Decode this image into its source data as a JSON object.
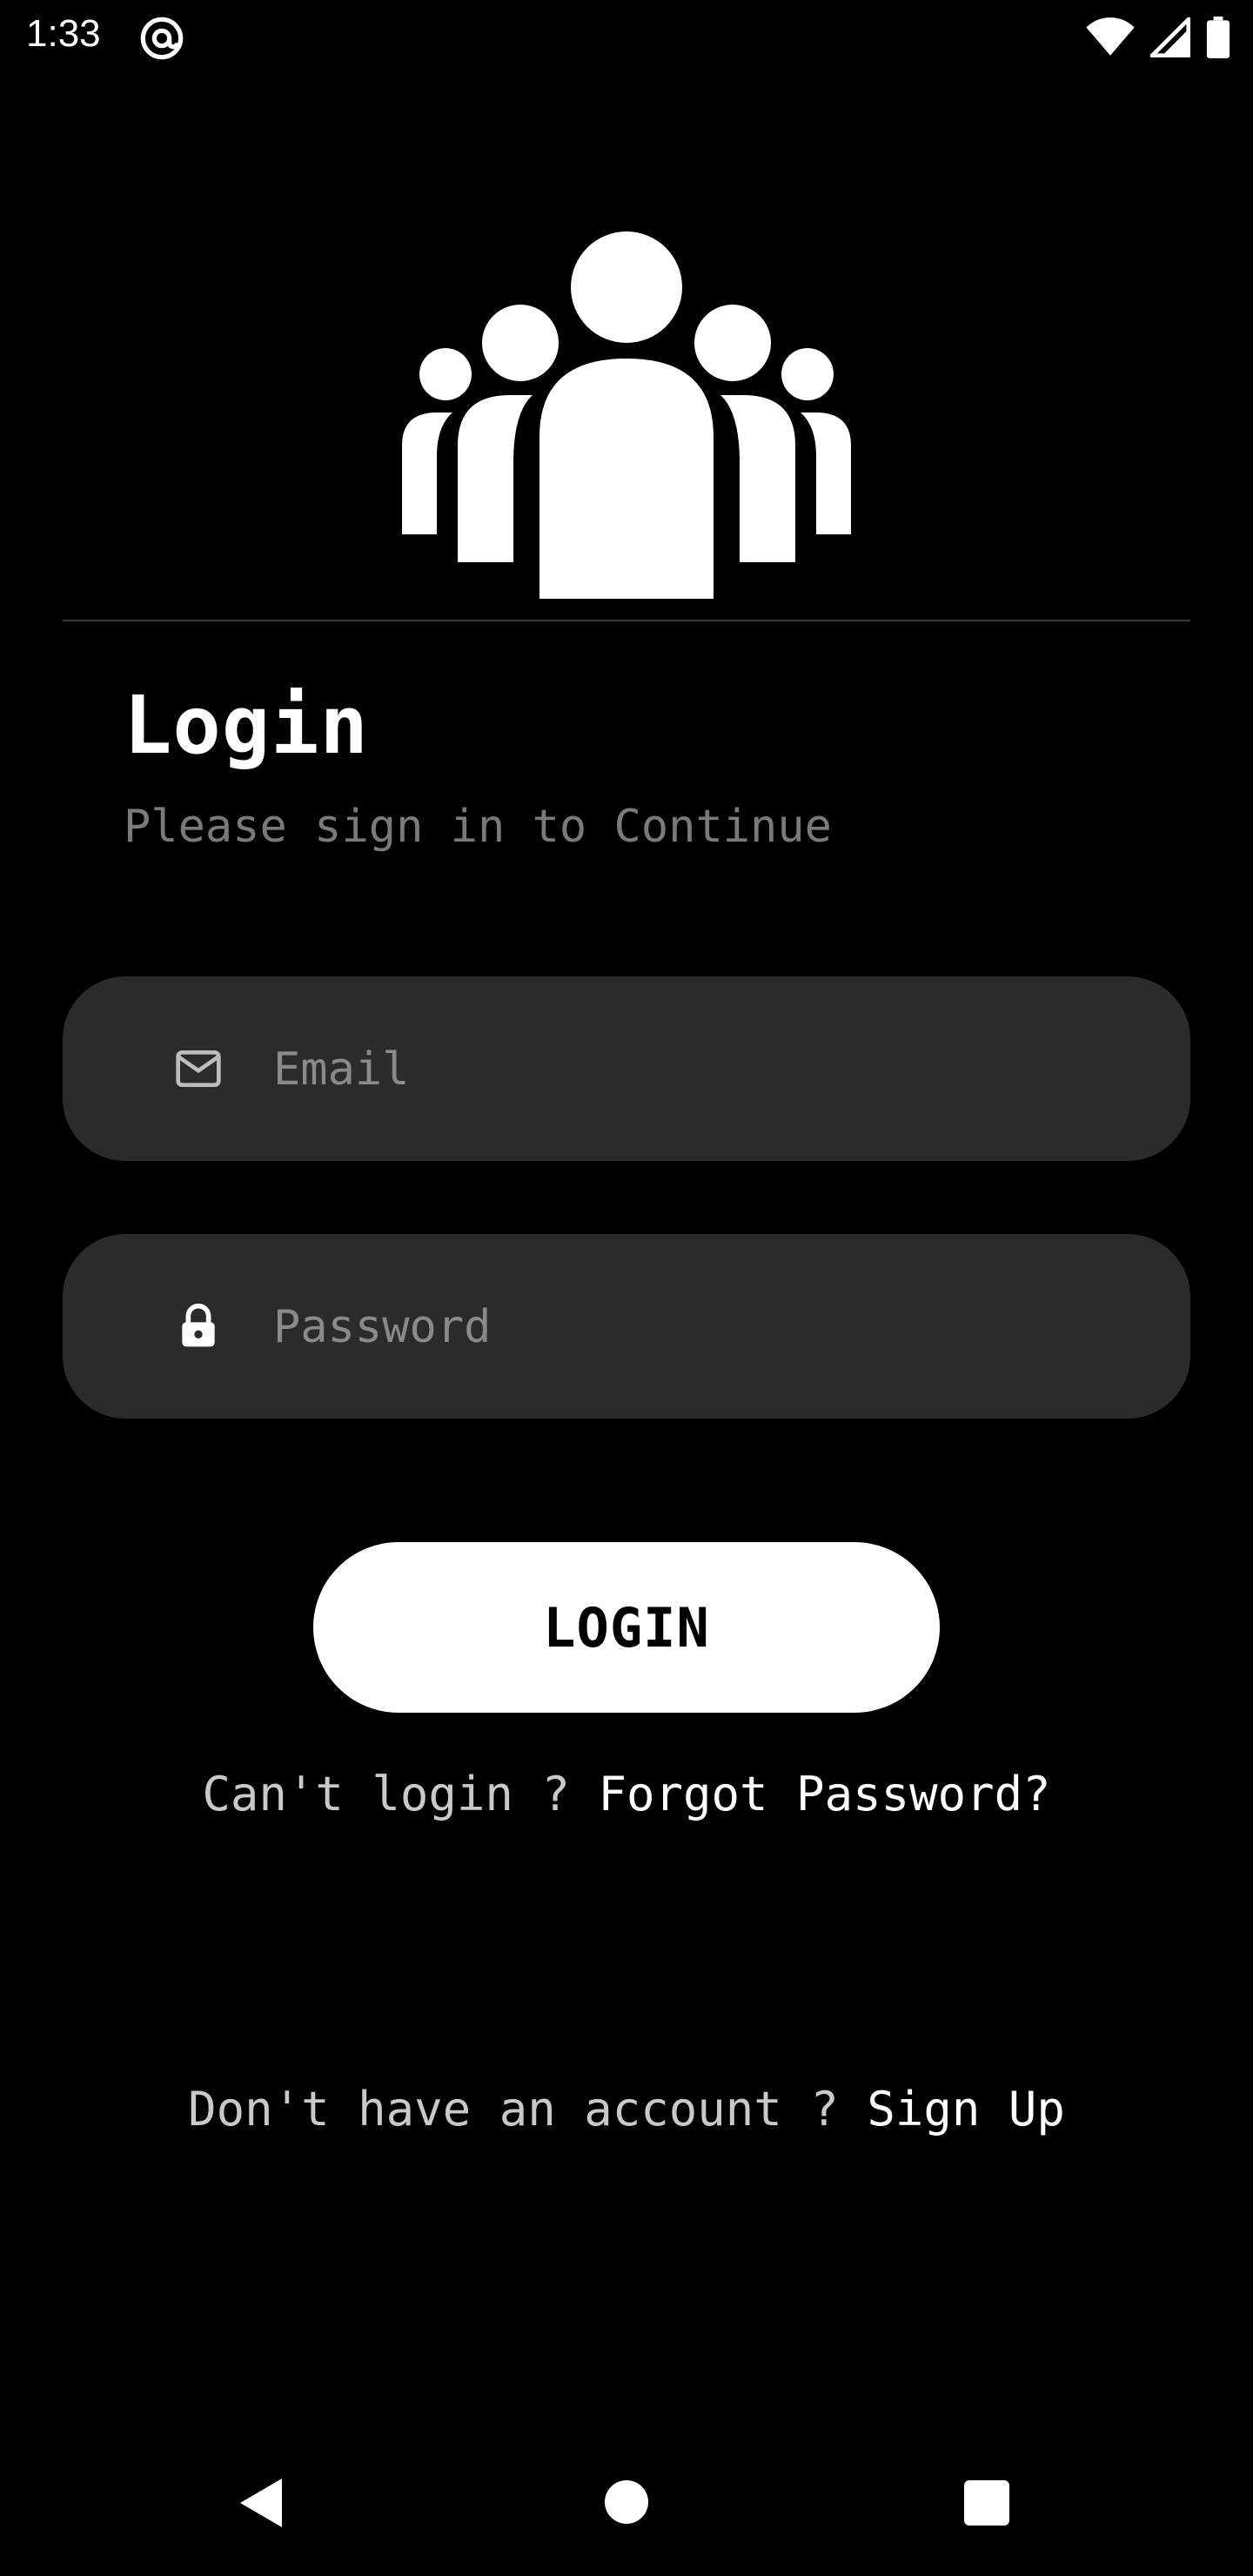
{
  "status_bar": {
    "time": "1:33",
    "icons": [
      "at-sign-icon",
      "wifi-icon",
      "signal-icon",
      "battery-icon"
    ]
  },
  "hero": {
    "icon": "group-people-icon"
  },
  "header": {
    "title": "Login",
    "subtitle": "Please sign in to Continue"
  },
  "form": {
    "email": {
      "placeholder": "Email",
      "value": "",
      "icon": "mail-icon"
    },
    "password": {
      "placeholder": "Password",
      "value": "",
      "icon": "lock-icon"
    },
    "login_label": "LOGIN"
  },
  "forgot": {
    "prefix": "Can't login ? ",
    "link": "Forgot Password?"
  },
  "signup": {
    "prefix": "Don't have an account ? ",
    "link": "Sign Up"
  },
  "nav": {
    "icons": [
      "back-icon",
      "home-icon",
      "recents-icon"
    ]
  },
  "colors": {
    "background": "#000000",
    "field_bg": "#2b2b2b",
    "button_bg": "#ffffff",
    "subtitle": "#7a7a7a"
  }
}
